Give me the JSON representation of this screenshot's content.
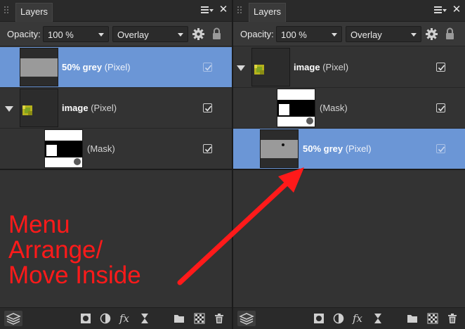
{
  "left_panel": {
    "tab_label": "Layers",
    "opacity_label": "Opacity:",
    "opacity_value": "100 %",
    "blend_mode": "Overlay",
    "layers": {
      "grey": {
        "name": "50% grey",
        "type": "(Pixel)"
      },
      "image": {
        "name": "image",
        "type": "(Pixel)"
      },
      "mask": {
        "type": "(Mask)"
      }
    }
  },
  "right_panel": {
    "tab_label": "Layers",
    "opacity_label": "Opacity:",
    "opacity_value": "100 %",
    "blend_mode": "Overlay",
    "layers": {
      "image": {
        "name": "image",
        "type": "(Pixel)"
      },
      "mask": {
        "type": "(Mask)"
      },
      "grey": {
        "name": "50% grey",
        "type": "(Pixel)"
      }
    }
  },
  "annotation": {
    "lines": [
      "Menu",
      "Arrange/",
      "Move Inside"
    ],
    "color": "#ff1a1a"
  },
  "colors": {
    "selection": "#6b96d6",
    "panel_bg": "#333333"
  },
  "icons": {
    "panel_menu": "hamburger-icon",
    "panel_close": "close-icon",
    "settings": "gear-icon",
    "lock": "lock-icon",
    "footer": [
      "layers-panel-icon",
      "mask-icon",
      "adjustment-icon",
      "fx-icon",
      "live-filter-icon",
      "folder-icon",
      "pixel-layer-icon",
      "trash-icon"
    ]
  }
}
